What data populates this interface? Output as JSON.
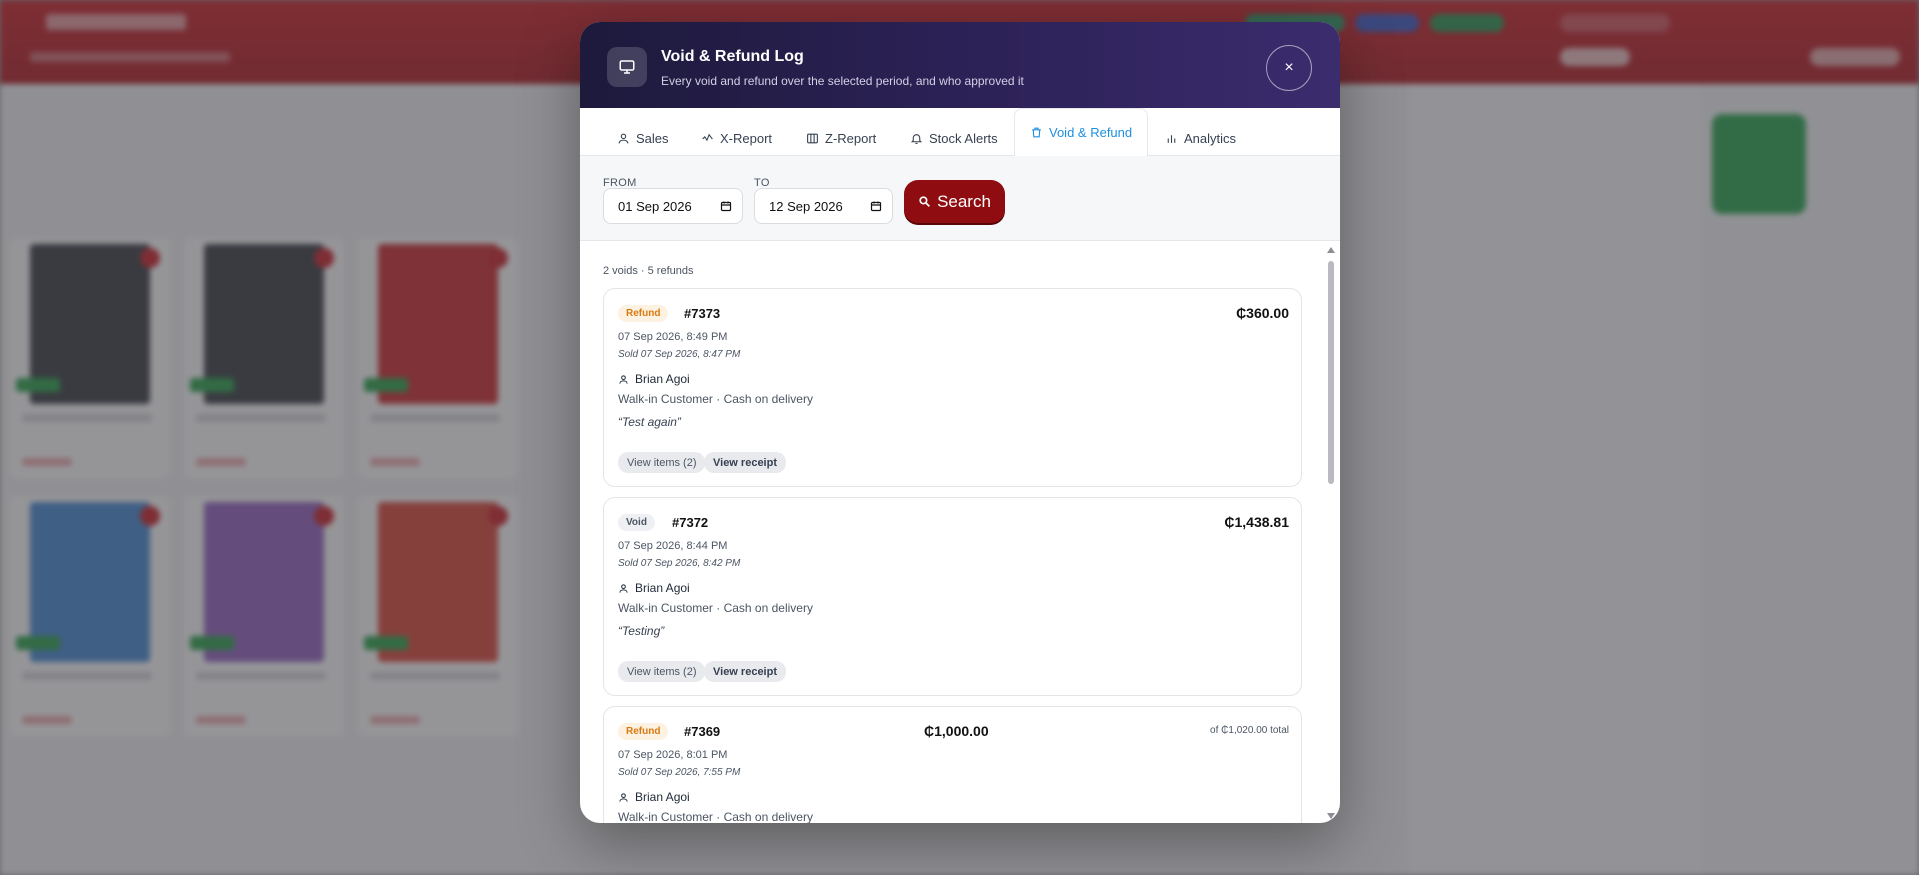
{
  "modal": {
    "title": "Void & Refund Log",
    "subtitle": "Every void and refund over the selected period, and who approved it",
    "close_label": "×"
  },
  "tabs": [
    {
      "label": "Sales",
      "icon": "user-icon"
    },
    {
      "label": "X-Report",
      "icon": "activity-icon"
    },
    {
      "label": "Z-Report",
      "icon": "columns-icon"
    },
    {
      "label": "Stock Alerts",
      "icon": "bell-icon"
    },
    {
      "label": "Void & Refund",
      "icon": "trash-icon",
      "active": true
    },
    {
      "label": "Analytics",
      "icon": "bar-chart-icon"
    }
  ],
  "filters": {
    "from_label": "FROM",
    "from_value": "01 Sep 2026",
    "to_label": "TO",
    "to_value": "12 Sep 2026",
    "search_label": "Search"
  },
  "summary": "2 voids · 5 refunds",
  "entries": [
    {
      "type": "Refund",
      "number": "#7373",
      "amount": "₵360.00",
      "date": "07 Sep 2026, 8:49 PM",
      "sold": "Sold 07 Sep 2026, 8:47 PM",
      "user": "Brian Agoi",
      "customer": "Walk-in Customer · Cash on delivery",
      "note": "“Test again”",
      "view_items": "View items (2)",
      "view_receipt": "View receipt"
    },
    {
      "type": "Void",
      "number": "#7372",
      "amount": "₵1,438.81",
      "date": "07 Sep 2026, 8:44 PM",
      "sold": "Sold 07 Sep 2026, 8:42 PM",
      "user": "Brian Agoi",
      "customer": "Walk-in Customer · Cash on delivery",
      "note": "“Testing”",
      "view_items": "View items (2)",
      "view_receipt": "View receipt"
    },
    {
      "type": "Refund",
      "number": "#7369",
      "amount": "₵1,000.00",
      "total": "of ₵1,020.00 total",
      "date": "07 Sep 2026, 8:01 PM",
      "sold": "Sold 07 Sep 2026, 7:55 PM",
      "user": "Brian Agoi",
      "customer": "Walk-in Customer · Cash on delivery"
    }
  ],
  "colors": {
    "header_start": "#1d1a3c",
    "header_end": "#3b2c6e",
    "active_tab": "#1d8fe0",
    "search_button": "#8f0d10",
    "refund_badge": "#d97a10"
  }
}
